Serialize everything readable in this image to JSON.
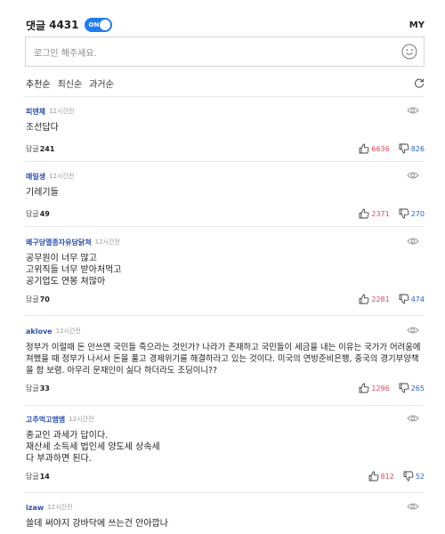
{
  "header": {
    "title": "댓글",
    "count": "4431",
    "toggle_label": "ON",
    "my_label": "MY"
  },
  "login": {
    "placeholder": "로그인 해주세요."
  },
  "sort": {
    "options": [
      "추천순",
      "최신순",
      "과거순"
    ]
  },
  "reply_label": "답글",
  "comments": [
    {
      "name": "피덴체",
      "time": "12시간전",
      "body": "조선답다",
      "replies": "241",
      "up": "6636",
      "down": "826"
    },
    {
      "name": "매일생",
      "time": "12시간전",
      "body": "기레기들",
      "replies": "49",
      "up": "2371",
      "down": "270"
    },
    {
      "name": "왜구당멸종자유당닭쳐",
      "time": "12시간전",
      "body": "공무원이 너무 많고\n고위직들 너무 받아처먹고\n공기업도 연봉 쳐많아",
      "replies": "70",
      "up": "2281",
      "down": "474"
    },
    {
      "name": "aklove",
      "time": "12시간전",
      "body": "정부가 이럴때 돈 안쓰면 국민들 죽으라는 것인가? 나라가 존재하고 국민들이 세금을 내는 이유는 국가가 어려움에 쳐했을 때 정부가 나서서 돈을 풀고 경제위기를 해결하라고 있는 것이다. 미국의 연방준비은행, 중국의 경기부양책을 함 보렴. 아무리 문재인이 싫다 하더라도 조딩이니??",
      "replies": "33",
      "up": "1296",
      "down": "265"
    },
    {
      "name": "고추먹고맴맴",
      "time": "12시간전",
      "body": "종교인 과세가 답이다.\n재산세 소득세 법인세  양도세  상속세\n다 부과하면  된다.",
      "replies": "14",
      "up": "812",
      "down": "52"
    },
    {
      "name": "izaw",
      "time": "12시간전",
      "body": "쓸데 써야지 강바닥에 쓰는건 안아깝나",
      "replies": "",
      "up": "",
      "down": ""
    }
  ],
  "colors": {
    "toggle_bg": "#1f7cf5",
    "name": "#2a4fb0",
    "up": "#e2475e",
    "down": "#2a62c8"
  }
}
